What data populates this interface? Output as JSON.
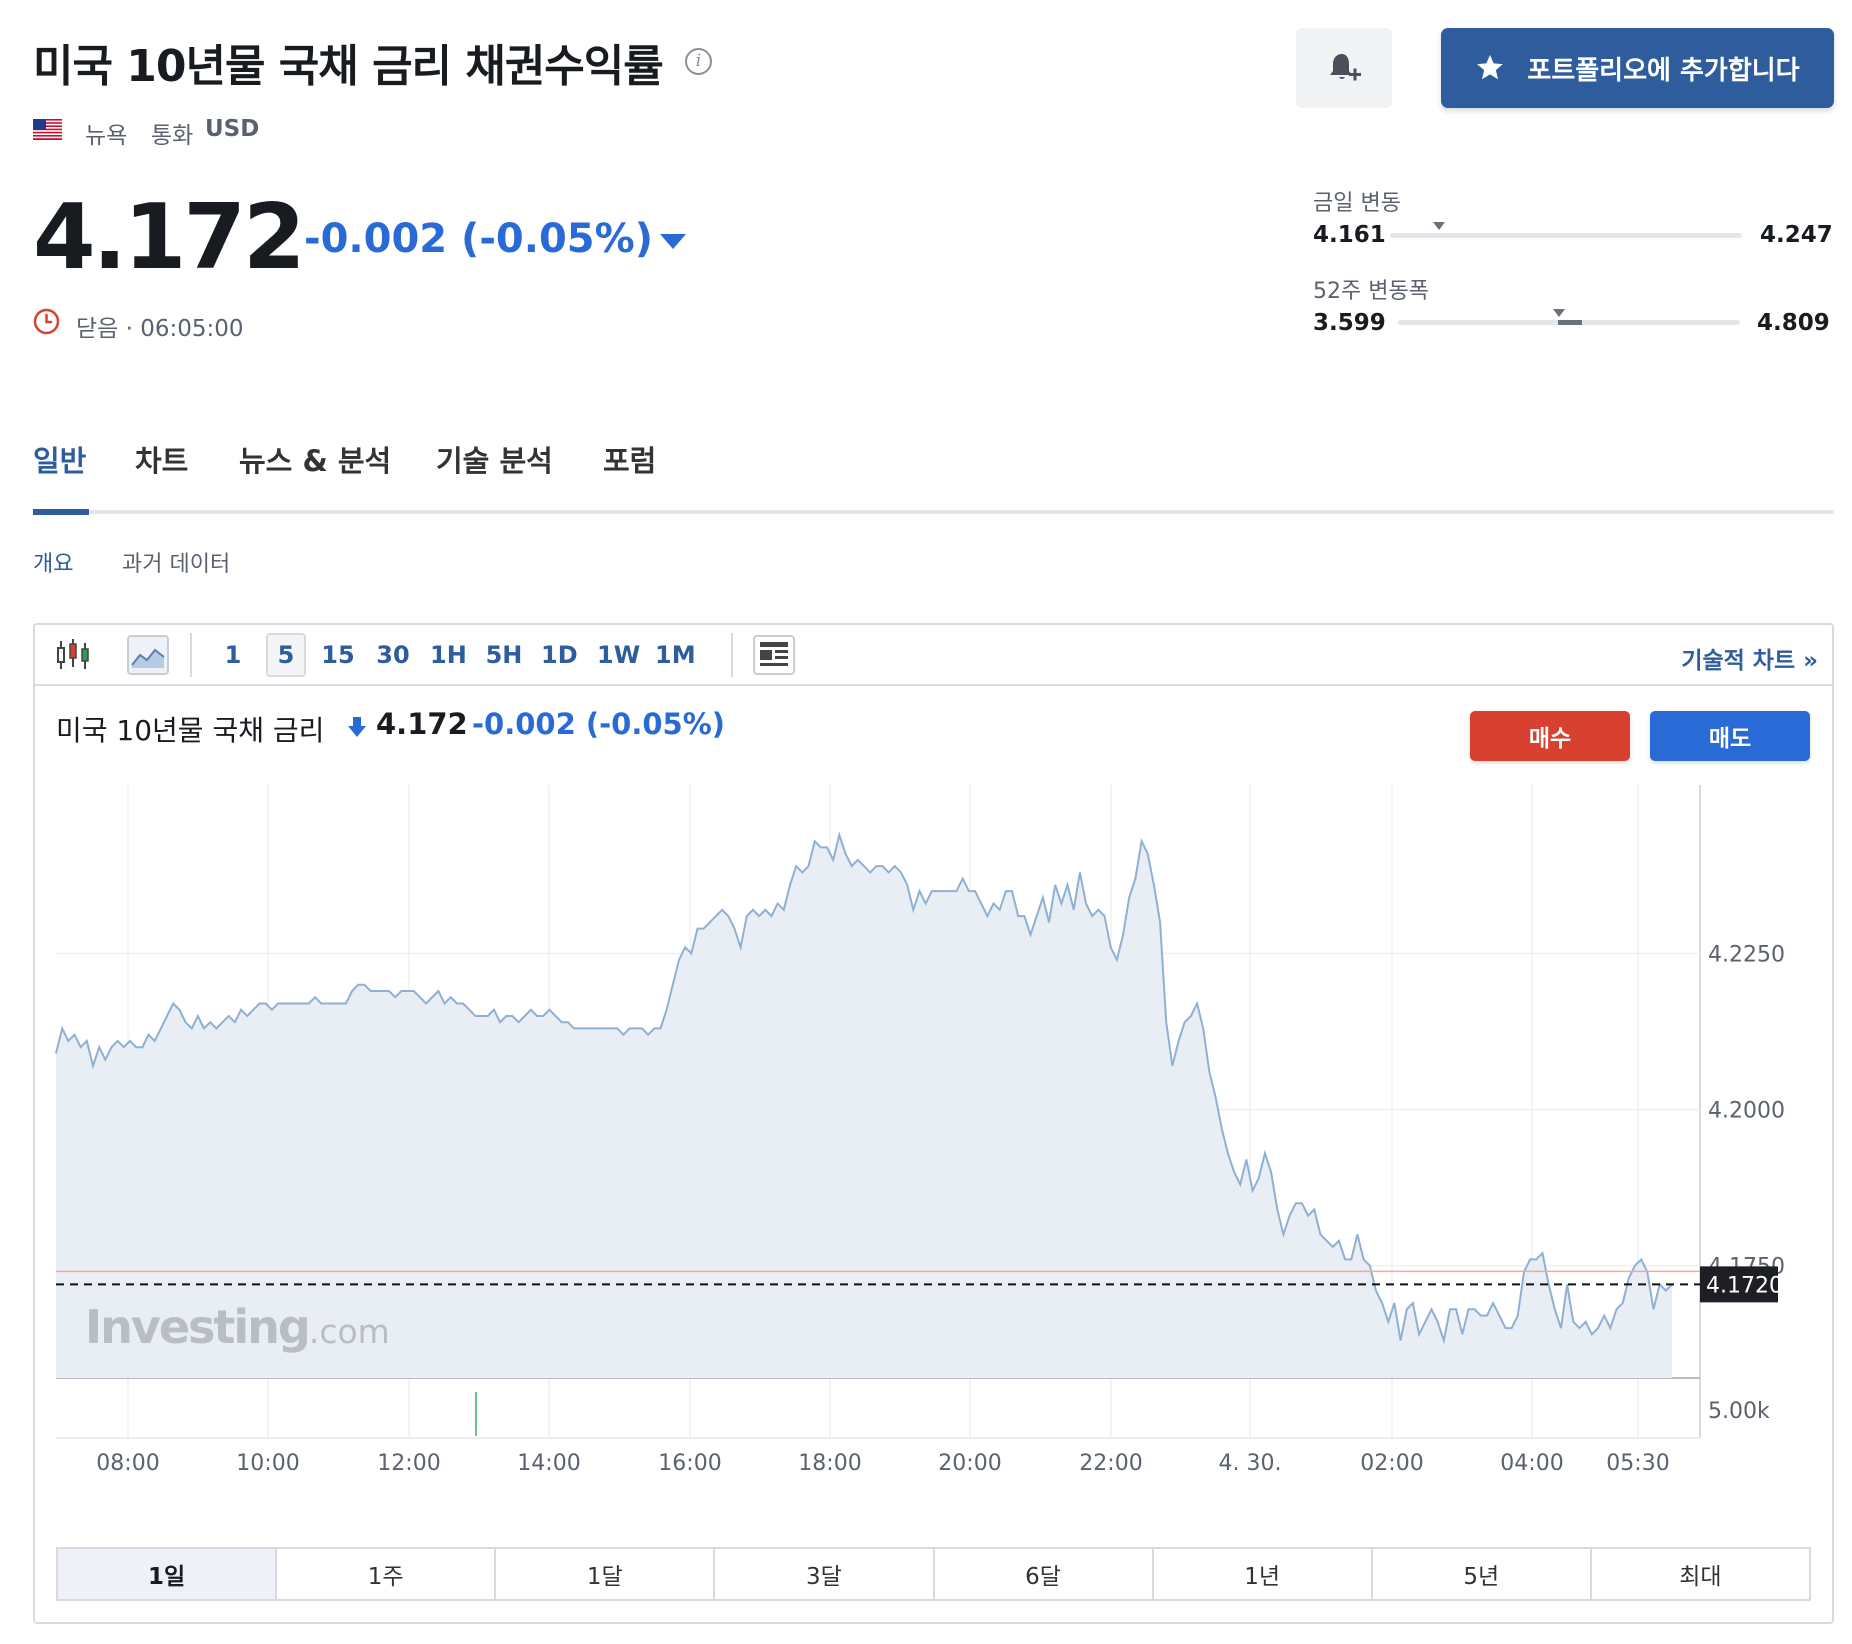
{
  "header": {
    "title": "미국 10년물 국채 금리 채권수익률",
    "info_icon": "info-icon",
    "exchange": "뉴욕",
    "currency_label": "통화",
    "currency": "USD",
    "portfolio_button": "포트폴리오에 추가합니다",
    "alert_icon": "bell-plus-icon"
  },
  "quote": {
    "price": "4.172",
    "change": "-0.002 (-0.05%)",
    "status": "닫음 · 06:05:00"
  },
  "ranges": {
    "day": {
      "label": "금일 변동",
      "low": "4.161",
      "high": "4.247",
      "position": 0.14
    },
    "week52": {
      "label": "52주 변동폭",
      "low": "3.599",
      "high": "4.809",
      "position": 0.47
    }
  },
  "tabs": [
    {
      "label": "일반"
    },
    {
      "label": "차트"
    },
    {
      "label": "뉴스 & 분석"
    },
    {
      "label": "기술 분석"
    },
    {
      "label": "포럼"
    }
  ],
  "subtabs": [
    {
      "label": "개요"
    },
    {
      "label": "과거 데이터"
    }
  ],
  "toolbar": {
    "intervals": [
      "1",
      "5",
      "15",
      "30",
      "1H",
      "5H",
      "1D",
      "1W",
      "1M"
    ],
    "selected_interval": "5",
    "tech_chart_link": "기술적 차트 »"
  },
  "chart_header": {
    "name": "미국 10년물 국채 금리",
    "price": "4.172",
    "change": "-0.002 (-0.05%)",
    "buy": "매수",
    "sell": "매도"
  },
  "watermark": {
    "main": "Investing",
    "suffix": ".com"
  },
  "periods": [
    "1일",
    "1주",
    "1달",
    "3달",
    "6달",
    "1년",
    "5년",
    "최대"
  ],
  "selected_period": "1일",
  "colors": {
    "brand_blue": "#2e5c9d",
    "down_blue": "#2a6ad6",
    "buy_red": "#d8412f",
    "line": "#8fb0d3",
    "area": "#e9eef5"
  },
  "chart_data": {
    "type": "area",
    "y_tick_labels": [
      "4.2250",
      "4.2000",
      "4.1750"
    ],
    "y_ticks": [
      4.225,
      4.2,
      4.175
    ],
    "ylim": [
      4.157,
      4.252
    ],
    "x_tick_labels": [
      "08:00",
      "10:00",
      "12:00",
      "14:00",
      "16:00",
      "18:00",
      "20:00",
      "22:00",
      "4. 30.",
      "02:00",
      "04:00",
      "05:30"
    ],
    "last_price_label": "4.1720",
    "last_price": 4.172,
    "volume_label": "5.00k",
    "grid": true,
    "series": [
      {
        "values": [
          4.209,
          4.213,
          4.211,
          4.212,
          4.21,
          4.211,
          4.207,
          4.21,
          4.208,
          4.21,
          4.211,
          4.21,
          4.211,
          4.21,
          4.21,
          4.212,
          4.211,
          4.213,
          4.215,
          4.217,
          4.216,
          4.214,
          4.213,
          4.215,
          4.213,
          4.214,
          4.213,
          4.214,
          4.215,
          4.214,
          4.216,
          4.215,
          4.216,
          4.217,
          4.217,
          4.216,
          4.217,
          4.217,
          4.217,
          4.217,
          4.217,
          4.217,
          4.218,
          4.217,
          4.217,
          4.217,
          4.217,
          4.217,
          4.219,
          4.22,
          4.22,
          4.219,
          4.219,
          4.219,
          4.219,
          4.218,
          4.219,
          4.219,
          4.219,
          4.218,
          4.217,
          4.218,
          4.219,
          4.217,
          4.218,
          4.217,
          4.217,
          4.216,
          4.215,
          4.215,
          4.215,
          4.216,
          4.214,
          4.215,
          4.215,
          4.214,
          4.215,
          4.216,
          4.215,
          4.215,
          4.216,
          4.215,
          4.214,
          4.214,
          4.213,
          4.213,
          4.213,
          4.213,
          4.213,
          4.213,
          4.213,
          4.213,
          4.212,
          4.213,
          4.213,
          4.213,
          4.212,
          4.213,
          4.213,
          4.216,
          4.22,
          4.224,
          4.226,
          4.225,
          4.229,
          4.229,
          4.23,
          4.231,
          4.232,
          4.231,
          4.229,
          4.226,
          4.231,
          4.232,
          4.231,
          4.232,
          4.231,
          4.233,
          4.232,
          4.236,
          4.239,
          4.238,
          4.239,
          4.243,
          4.242,
          4.242,
          4.24,
          4.244,
          4.241,
          4.239,
          4.24,
          4.239,
          4.238,
          4.239,
          4.239,
          4.238,
          4.239,
          4.238,
          4.236,
          4.232,
          4.235,
          4.233,
          4.235,
          4.235,
          4.235,
          4.235,
          4.235,
          4.237,
          4.235,
          4.235,
          4.233,
          4.231,
          4.233,
          4.232,
          4.235,
          4.235,
          4.231,
          4.231,
          4.228,
          4.231,
          4.234,
          4.23,
          4.236,
          4.233,
          4.236,
          4.232,
          4.238,
          4.233,
          4.231,
          4.232,
          4.231,
          4.226,
          4.224,
          4.228,
          4.234,
          4.237,
          4.243,
          4.241,
          4.236,
          4.23,
          4.214,
          4.207,
          4.211,
          4.214,
          4.215,
          4.217,
          4.213,
          4.206,
          4.202,
          4.197,
          4.193,
          4.19,
          4.188,
          4.192,
          4.187,
          4.189,
          4.193,
          4.19,
          4.184,
          4.18,
          4.183,
          4.185,
          4.185,
          4.183,
          4.184,
          4.18,
          4.179,
          4.178,
          4.179,
          4.176,
          4.176,
          4.18,
          4.176,
          4.175,
          4.171,
          4.169,
          4.166,
          4.169,
          4.163,
          4.168,
          4.169,
          4.164,
          4.166,
          4.168,
          4.166,
          4.163,
          4.168,
          4.168,
          4.164,
          4.168,
          4.168,
          4.167,
          4.167,
          4.169,
          4.167,
          4.165,
          4.165,
          4.167,
          4.174,
          4.176,
          4.176,
          4.177,
          4.172,
          4.168,
          4.165,
          4.172,
          4.166,
          4.165,
          4.166,
          4.164,
          4.165,
          4.167,
          4.165,
          4.168,
          4.169,
          4.173,
          4.175,
          4.176,
          4.174,
          4.168,
          4.172,
          4.171,
          4.172
        ]
      }
    ]
  }
}
